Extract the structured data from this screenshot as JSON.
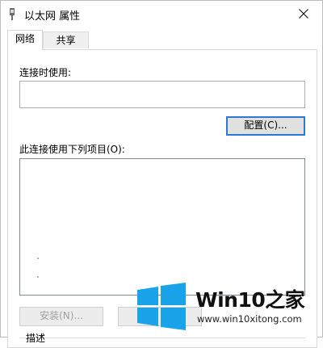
{
  "window": {
    "title": "以太网 属性",
    "icon": "network-adapter-icon",
    "close_icon": "close-icon"
  },
  "tabs": [
    {
      "label": "网络",
      "active": true
    },
    {
      "label": "共享",
      "active": false
    }
  ],
  "networking": {
    "connect_using_label": "连接时使用:",
    "connect_using_value": "",
    "configure_button": "配置(C)...",
    "items_label": "此连接使用下列项目(O):",
    "items": [],
    "install_button": "安装(N)...",
    "uninstall_button": "",
    "description_label": "描述"
  },
  "watermark": {
    "brand": "Win10",
    "brand_suffix": "之家",
    "url": "www.win10xitong.com",
    "logo_color": "#1aa3e8"
  },
  "colors": {
    "focus_border": "#2a7ad3",
    "disabled_text": "#a0a0a0"
  }
}
